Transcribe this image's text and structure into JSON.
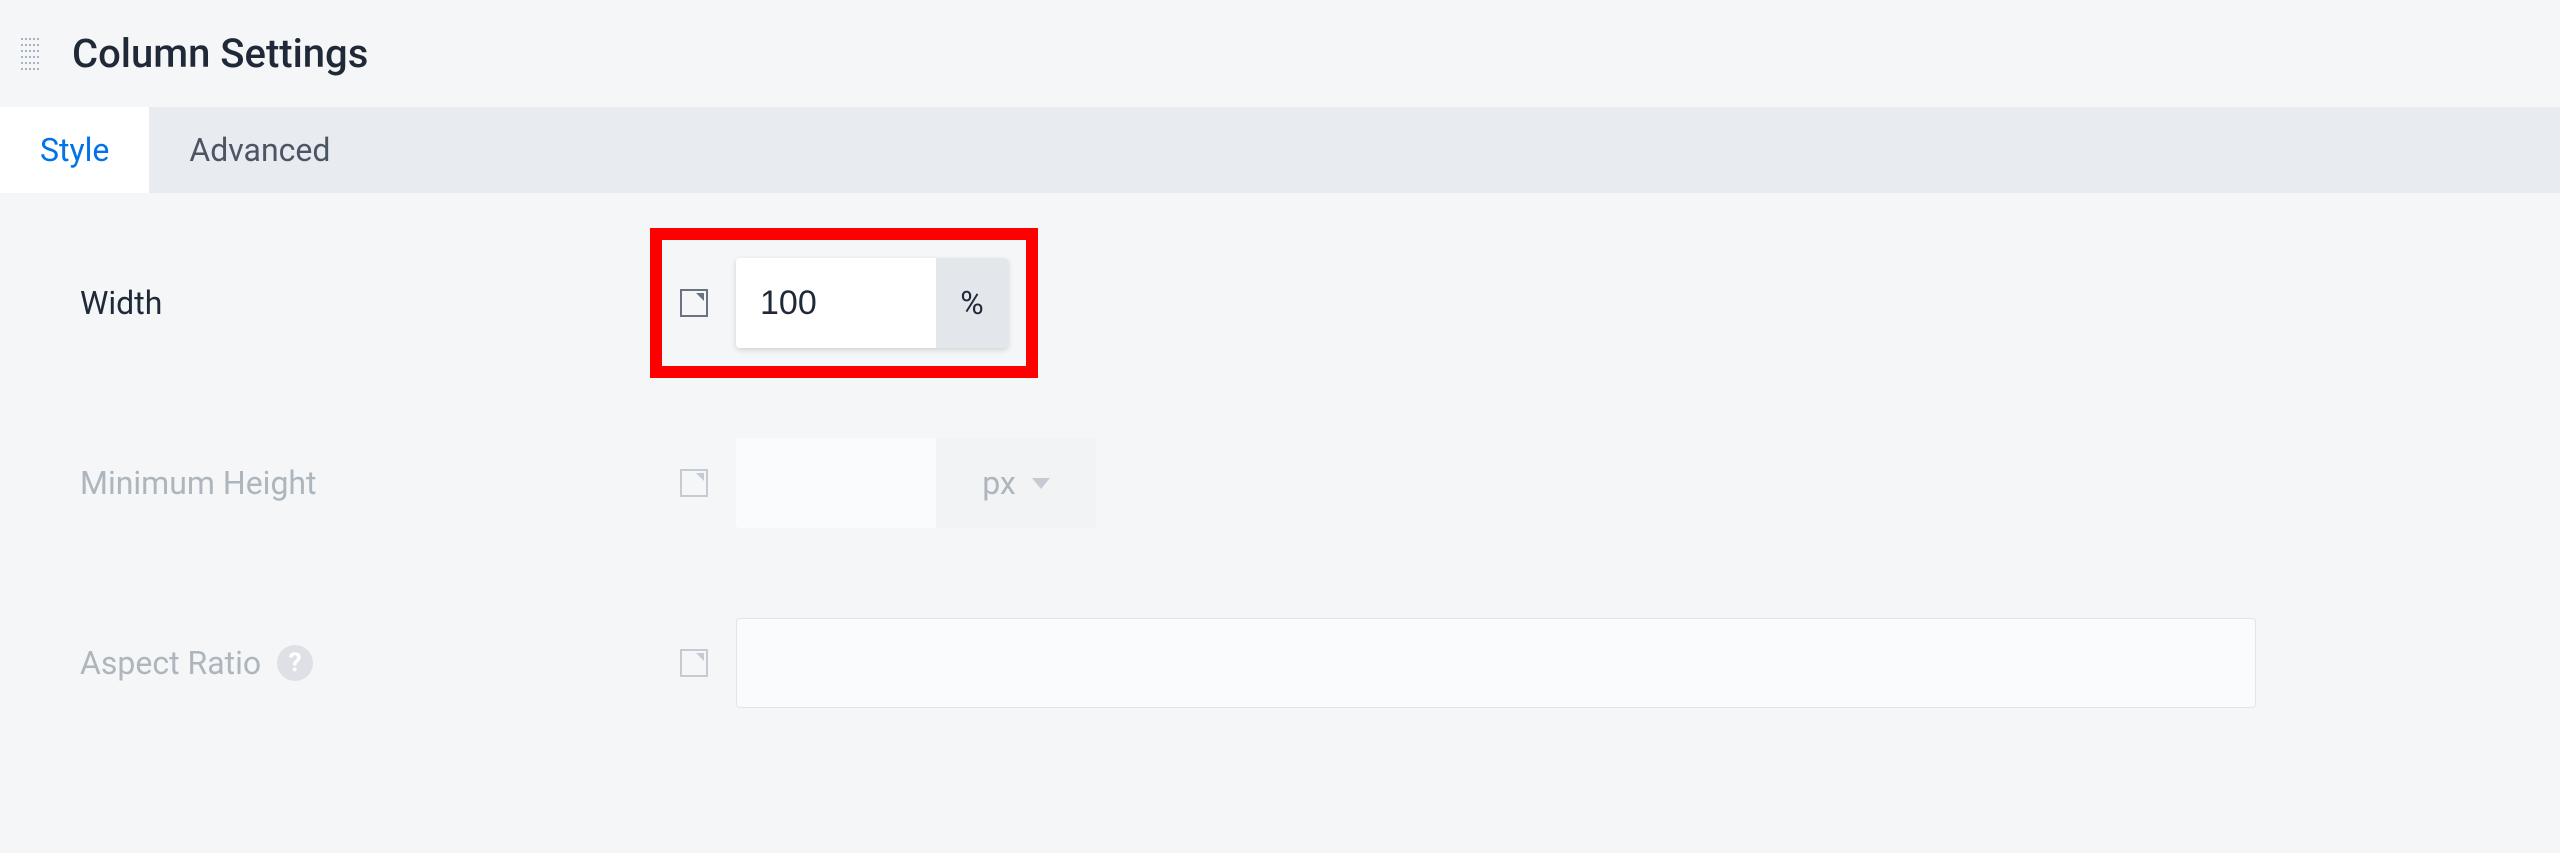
{
  "panel": {
    "title": "Column Settings"
  },
  "tabs": [
    {
      "label": "Style",
      "active": true
    },
    {
      "label": "Advanced",
      "active": false
    }
  ],
  "settings": {
    "width": {
      "label": "Width",
      "value": "100",
      "unit": "%",
      "enabled": true,
      "highlighted": true
    },
    "minHeight": {
      "label": "Minimum Height",
      "value": "",
      "unit": "px",
      "enabled": false
    },
    "aspectRatio": {
      "label": "Aspect Ratio",
      "value": "",
      "enabled": false,
      "helpText": "?"
    }
  }
}
